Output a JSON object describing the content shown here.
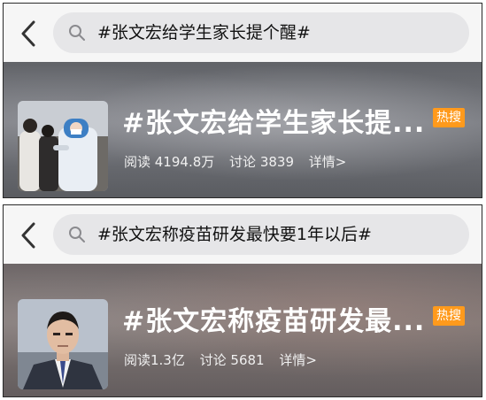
{
  "cards": [
    {
      "search_query": "#张文宏给学生家长提个醒#",
      "title": "#张文宏给学生家长提...",
      "badge": "热搜",
      "reads": "阅读 4194.8万",
      "discussions": "讨论 3839",
      "details_link": "详情>",
      "thumbnail": "medical-workers-in-protective-suits-photo"
    },
    {
      "search_query": "#张文宏称疫苗研发最快要1年以后#",
      "title": "#张文宏称疫苗研发最...",
      "badge": "热搜",
      "reads": "阅读1.3亿",
      "discussions": "讨论 5681",
      "details_link": "详情>",
      "thumbnail": "man-in-suit-portrait-photo"
    }
  ],
  "colors": {
    "badge_bg": "#ff9a1c",
    "search_bg": "#e6e6e8",
    "header_bg": "#f6f6f6"
  }
}
